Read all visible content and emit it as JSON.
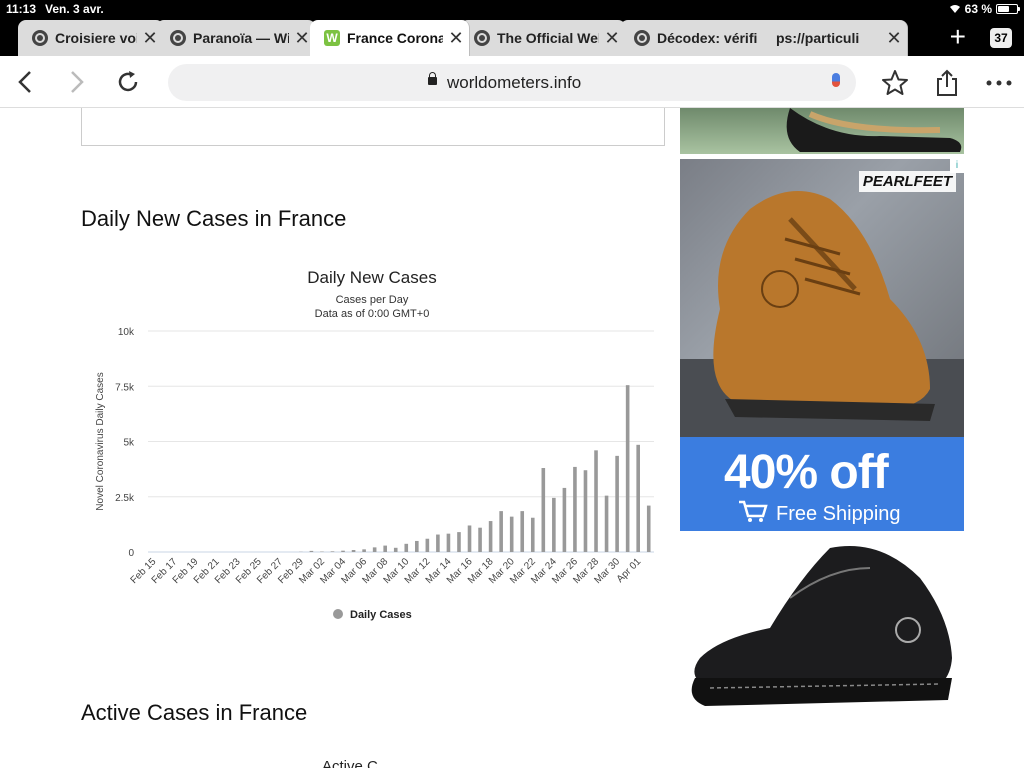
{
  "status": {
    "time": "11:13",
    "date": "Ven. 3 avr.",
    "battery": "63 %",
    "battery_level": 0.63
  },
  "tabs": [
    {
      "label": "Croisiere voilier",
      "icon": "globe-icon",
      "active": false
    },
    {
      "label": "Paranoïa — Wiki",
      "icon": "globe-icon",
      "active": false
    },
    {
      "label": "France Coronav",
      "icon": "worldometer-icon",
      "active": true
    },
    {
      "label": "The Official Wel",
      "icon": "globe-icon",
      "active": false
    },
    {
      "label": "Décodex: vérific",
      "icon": "globe-icon",
      "active": false
    },
    {
      "label": "ps://particuli",
      "icon": "",
      "active": false
    }
  ],
  "tab_count": "37",
  "new_tab": "+",
  "toolbar": {
    "url": "worldometers.info"
  },
  "page": {
    "section_daily": "Daily New Cases in France",
    "section_active": "Active Cases in France",
    "active_chart_title_partial": "Active C"
  },
  "ads": {
    "brand": "PEARLFEET",
    "discount": "40% off",
    "shipping": "Free Shipping"
  },
  "chart_data": {
    "type": "bar",
    "title": "Daily New Cases",
    "subtitle": "Cases per Day",
    "subtitle2": "Data as of 0:00 GMT+0",
    "ylabel": "Novel Coronavirus Daily Cases",
    "legend": "Daily Cases",
    "ylim": [
      0,
      10000
    ],
    "yticks": [
      "0",
      "2.5k",
      "5k",
      "7.5k",
      "10k"
    ],
    "color": "#999999",
    "x_tick_labels": [
      "Feb 15",
      "Feb 17",
      "Feb 19",
      "Feb 21",
      "Feb 23",
      "Feb 25",
      "Feb 27",
      "Feb 29",
      "Mar 02",
      "Mar 04",
      "Mar 06",
      "Mar 08",
      "Mar 10",
      "Mar 12",
      "Mar 14",
      "Mar 16",
      "Mar 18",
      "Mar 20",
      "Mar 22",
      "Mar 24",
      "Mar 26",
      "Mar 28",
      "Mar 30",
      "Apr 01"
    ],
    "categories": [
      "Feb 15",
      "Feb 16",
      "Feb 17",
      "Feb 18",
      "Feb 19",
      "Feb 20",
      "Feb 21",
      "Feb 22",
      "Feb 23",
      "Feb 24",
      "Feb 25",
      "Feb 26",
      "Feb 27",
      "Feb 28",
      "Feb 29",
      "Mar 01",
      "Mar 02",
      "Mar 03",
      "Mar 04",
      "Mar 05",
      "Mar 06",
      "Mar 07",
      "Mar 08",
      "Mar 09",
      "Mar 10",
      "Mar 11",
      "Mar 12",
      "Mar 13",
      "Mar 14",
      "Mar 15",
      "Mar 16",
      "Mar 17",
      "Mar 18",
      "Mar 19",
      "Mar 20",
      "Mar 21",
      "Mar 22",
      "Mar 23",
      "Mar 24",
      "Mar 25",
      "Mar 26",
      "Mar 27",
      "Mar 28",
      "Mar 29",
      "Mar 30",
      "Mar 31",
      "Apr 01",
      "Apr 02"
    ],
    "values": [
      0,
      0,
      0,
      0,
      0,
      0,
      0,
      0,
      0,
      0,
      0,
      0,
      0,
      0,
      10,
      50,
      20,
      30,
      60,
      90,
      120,
      210,
      290,
      190,
      370,
      500,
      600,
      790,
      830,
      900,
      1200,
      1100,
      1400,
      1850,
      1600,
      1850,
      1550,
      3800,
      2450,
      2900,
      3850,
      3700,
      4600,
      2550,
      4350,
      7550,
      4850,
      2100
    ]
  }
}
